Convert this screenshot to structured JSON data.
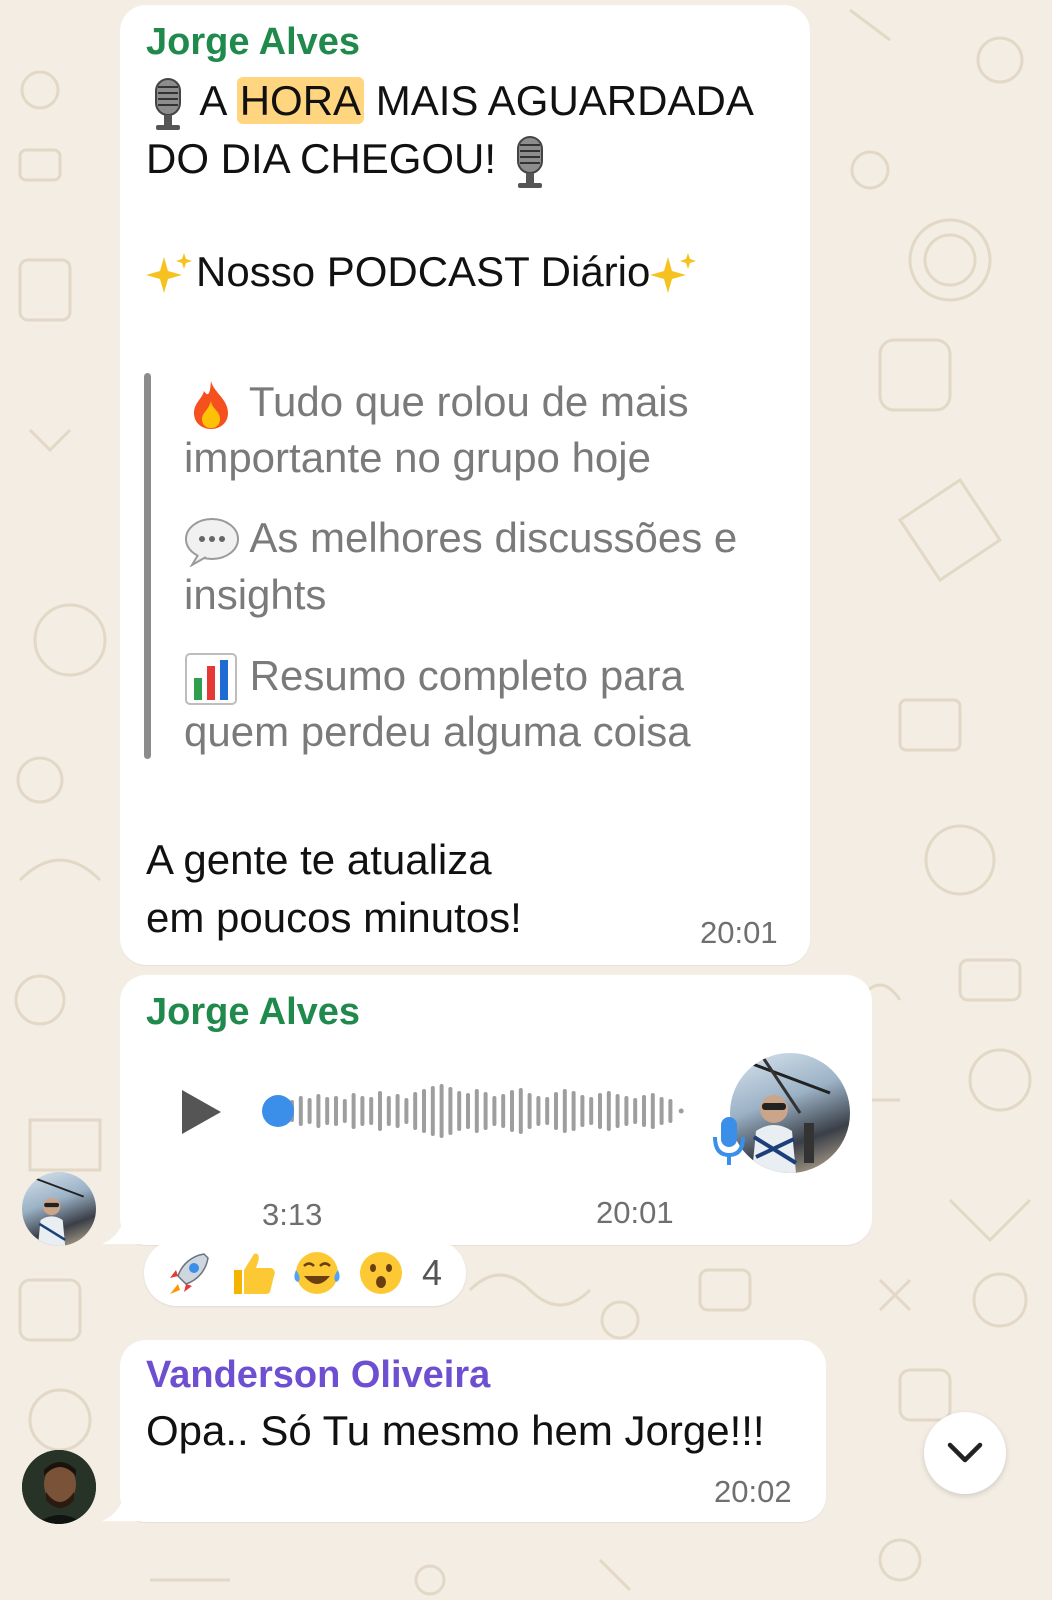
{
  "chat": {
    "messages": [
      {
        "sender": "Jorge Alves",
        "sender_color": "#1f8a4c",
        "line1_pre": " A ",
        "line1_highlight": "HORA",
        "line1_post": " MAIS AGUARDADA",
        "line2": "DO DIA CHEGOU! ",
        "podcast_title": "Nosso PODCAST Diário",
        "quote_items": [
          {
            "icon": "fire-icon",
            "line1": "Tudo que rolou de mais",
            "line2": "importante no grupo hoje"
          },
          {
            "icon": "speech-bubble-icon",
            "line1": "As melhores discussões e",
            "line2": "insights"
          },
          {
            "icon": "bar-chart-icon",
            "line1": "Resumo completo para",
            "line2": "quem perdeu alguma coisa"
          }
        ],
        "closing_line1": "A gente te atualiza",
        "closing_line2": "em poucos minutos!",
        "time": "20:01"
      },
      {
        "sender": "Jorge Alves",
        "sender_color": "#1f8a4c",
        "audio_duration": "3:13",
        "time": "20:01",
        "reactions": [
          "rocket-emoji",
          "thumbs-up-emoji",
          "tears-of-joy-emoji",
          "surprised-emoji"
        ],
        "reaction_count": "4"
      },
      {
        "sender": "Vanderson Oliveira",
        "sender_color": "#6e4fd1",
        "text": "Opa.. Só Tu mesmo hem Jorge!!!",
        "time": "20:02"
      }
    ],
    "colors": {
      "background": "#f3ede4",
      "bubble": "#ffffff",
      "highlight": "#ffd57f",
      "audio_progress": "#3b8fe8",
      "quote_bar": "#8c8c8c"
    }
  }
}
